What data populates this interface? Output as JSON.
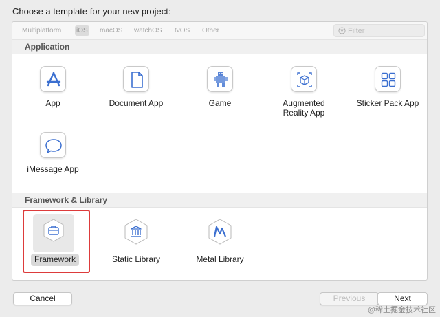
{
  "prompt": "Choose a template for your new project:",
  "platforms": [
    {
      "label": "Multiplatform"
    },
    {
      "label": "iOS"
    },
    {
      "label": "macOS"
    },
    {
      "label": "watchOS"
    },
    {
      "label": "tvOS"
    },
    {
      "label": "Other"
    }
  ],
  "selected_platform": "iOS",
  "filter": {
    "placeholder": "Filter",
    "value": "",
    "icon": "filter-icon"
  },
  "sections": [
    {
      "title": "Application",
      "items": [
        {
          "label": "App",
          "icon": "app-store-icon"
        },
        {
          "label": "Document App",
          "icon": "document-icon"
        },
        {
          "label": "Game",
          "icon": "game-icon"
        },
        {
          "label": "Augmented\nReality App",
          "icon": "ar-cube-icon"
        },
        {
          "label": "Sticker Pack App",
          "icon": "sticker-grid-icon"
        },
        {
          "label": "iMessage App",
          "icon": "message-bubble-icon"
        }
      ]
    },
    {
      "title": "Framework & Library",
      "items": [
        {
          "label": "Framework",
          "icon": "toolbox-icon",
          "selected": true
        },
        {
          "label": "Static Library",
          "icon": "library-building-icon"
        },
        {
          "label": "Metal Library",
          "icon": "metal-icon"
        }
      ]
    }
  ],
  "buttons": {
    "cancel": "Cancel",
    "previous": "Previous",
    "next": "Next"
  },
  "watermark": "@稀土掘金技术社区",
  "colors": {
    "accent": "#3b6fd0",
    "selection_border": "#dd3b3b"
  }
}
